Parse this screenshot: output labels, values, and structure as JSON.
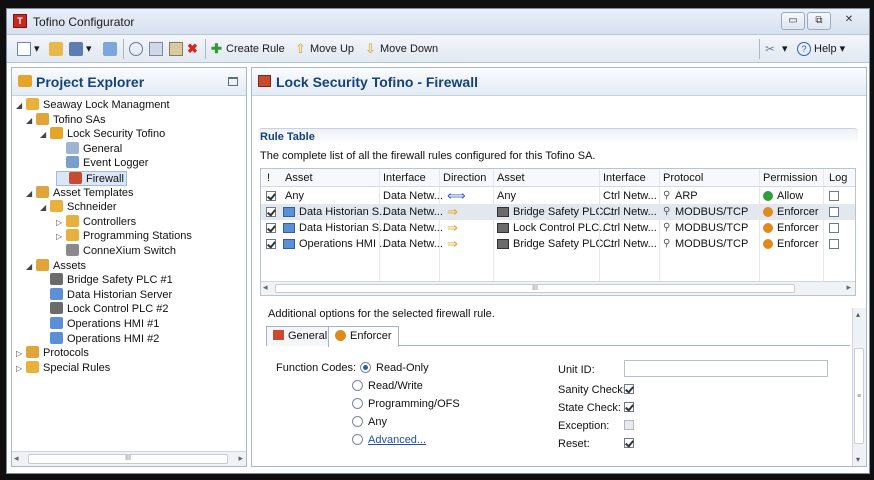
{
  "window": {
    "title": "Tofino Configurator",
    "app_icon": "T",
    "min": "▭",
    "max": "⧉",
    "close": "✕"
  },
  "toolbar": {
    "create_rule": "Create Rule",
    "move_up": "Move Up",
    "move_down": "Move Down",
    "help": "Help"
  },
  "left": {
    "title": "Project Explorer",
    "tree": [
      {
        "label": "Seaway Lock Managment",
        "arrow": "◢",
        "icon": "folder-open-icon",
        "color": "#e7b13c"
      },
      {
        "label": "Tofino SAs",
        "arrow": "◢",
        "icon": "folder-icon",
        "color": "#e0a43a"
      },
      {
        "label": "Lock Security Tofino",
        "arrow": "◢",
        "icon": "lock-device-icon",
        "color": "#e3a52a"
      },
      {
        "label": "General",
        "arrow": "",
        "icon": "general-icon",
        "color": "#9db4d4"
      },
      {
        "label": "Event Logger",
        "arrow": "",
        "icon": "logger-icon",
        "color": "#7a9fcf"
      },
      {
        "label": "Firewall",
        "arrow": "",
        "icon": "firewall-icon",
        "color": "#c84b2f"
      },
      {
        "label": "Asset Templates",
        "arrow": "◢",
        "icon": "folder-icon",
        "color": "#e0a43a"
      },
      {
        "label": "Schneider",
        "arrow": "◢",
        "icon": "folder-open-icon",
        "color": "#e7b13c"
      },
      {
        "label": "Controllers",
        "arrow": "▷",
        "icon": "folder-open-icon",
        "color": "#e7b13c"
      },
      {
        "label": "Programming Stations",
        "arrow": "▷",
        "icon": "folder-open-icon",
        "color": "#e7b13c"
      },
      {
        "label": "ConneXium Switch",
        "arrow": "",
        "icon": "switch-icon",
        "color": "#8a8a8a"
      },
      {
        "label": "Assets",
        "arrow": "◢",
        "icon": "folder-icon",
        "color": "#e0a43a"
      },
      {
        "label": "Bridge Safety PLC #1",
        "arrow": "",
        "icon": "plc-icon",
        "color": "#6b6b6b"
      },
      {
        "label": "Data Historian Server",
        "arrow": "",
        "icon": "monitor-icon",
        "color": "#5b8fd6"
      },
      {
        "label": "Lock Control PLC #2",
        "arrow": "",
        "icon": "plc-icon",
        "color": "#6b6b6b"
      },
      {
        "label": "Operations HMI #1",
        "arrow": "",
        "icon": "monitor-icon",
        "color": "#5b8fd6"
      },
      {
        "label": "Operations HMI #2",
        "arrow": "",
        "icon": "monitor-icon",
        "color": "#5b8fd6"
      },
      {
        "label": "Protocols",
        "arrow": "▷",
        "icon": "folder-icon",
        "color": "#e0a43a"
      },
      {
        "label": "Special Rules",
        "arrow": "▷",
        "icon": "folder-open-icon",
        "color": "#e7b13c"
      }
    ],
    "scroll": "III"
  },
  "right": {
    "title": "Lock Security Tofino - Firewall",
    "section": "Rule Table",
    "desc": "The complete list of all the firewall rules configured for this Tofino SA.",
    "columns": [
      "!",
      "Asset",
      "Interface",
      "Direction",
      "Asset",
      "Interface",
      "Protocol",
      "Permission",
      "Log"
    ],
    "rows": [
      {
        "check": true,
        "asset1": "Any",
        "iface1": "Data Netw...",
        "dir": "⟺",
        "asset2": "Any",
        "iface2": "Ctrl Netw...",
        "protocol": "ARP",
        "permission": "Allow",
        "perm_color": "#2f9e3b",
        "log": false,
        "icon1": "",
        "icon2": ""
      },
      {
        "check": true,
        "asset1": "Data Historian S...",
        "iface1": "Data Netw...",
        "dir": "⇒",
        "asset2": "Bridge Safety PLC...",
        "iface2": "Ctrl Netw...",
        "protocol": "MODBUS/TCP",
        "permission": "Enforcer",
        "perm_color": "#e08a1e",
        "log": false,
        "icon1": "monitor-icon",
        "icon2": "plc-icon"
      },
      {
        "check": true,
        "asset1": "Data Historian S...",
        "iface1": "Data Netw...",
        "dir": "⇒",
        "asset2": "Lock Control PLC...",
        "iface2": "Ctrl Netw...",
        "protocol": "MODBUS/TCP",
        "permission": "Enforcer",
        "perm_color": "#e08a1e",
        "log": false,
        "icon1": "monitor-icon",
        "icon2": "plc-icon"
      },
      {
        "check": true,
        "asset1": "Operations HMI ...",
        "iface1": "Data Netw...",
        "dir": "⇒",
        "asset2": "Bridge Safety PLC...",
        "iface2": "Ctrl Netw...",
        "protocol": "MODBUS/TCP",
        "permission": "Enforcer",
        "perm_color": "#e08a1e",
        "log": false,
        "icon1": "monitor-icon",
        "icon2": "plc-icon"
      }
    ],
    "hscroll": "III",
    "options_label": "Additional options for the selected firewall rule.",
    "tabs": [
      "General",
      "Enforcer"
    ],
    "function_codes_label": "Function Codes:",
    "function_codes": [
      "Read-Only",
      "Read/Write",
      "Programming/OFS",
      "Any",
      "Advanced..."
    ],
    "selected_code": "Read-Only",
    "fields": {
      "unit_id": "Unit ID:",
      "sanity": "Sanity Check:",
      "state": "State Check:",
      "exception": "Exception:",
      "reset": "Reset:"
    },
    "checks": {
      "sanity": true,
      "state": true,
      "exception": false,
      "reset": true
    }
  }
}
